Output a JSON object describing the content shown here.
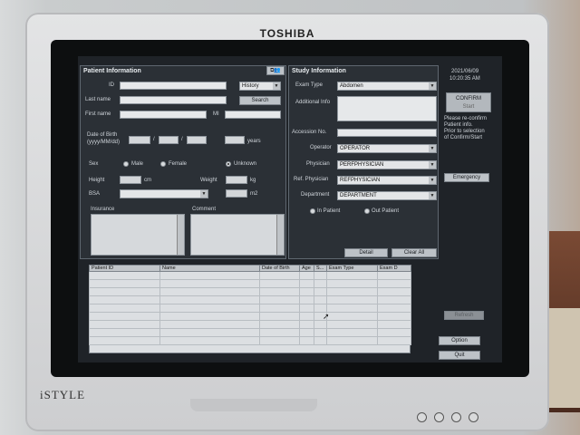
{
  "device": {
    "brand": "TOSHIBA",
    "model": "iSTYLE"
  },
  "patient": {
    "title": "Patient Information",
    "id_label": "ID",
    "history_option": "History",
    "last_name_label": "Last name",
    "search_button": "Search",
    "first_name_label": "First name",
    "mi_label": "MI",
    "dob_label_1": "Date of Birth",
    "dob_label_2": "(yyyy/MM/dd)",
    "slash": "/",
    "years_label": "years",
    "sex_label": "Sex",
    "male": "Male",
    "female": "Female",
    "unknown": "Unknown",
    "height_label": "Height",
    "height_unit": "cm",
    "weight_label": "Weight",
    "weight_unit": "kg",
    "bsa_label": "BSA",
    "bsa_unit": "m2",
    "insurance_label": "Insurance",
    "comment_label": "Comment"
  },
  "study": {
    "title": "Study Information",
    "exam_type_label": "Exam Type",
    "exam_type_value": "Abdomen",
    "additional_info_label": "Additional Info",
    "accession_label": "Accession No.",
    "operator_label": "Operator",
    "operator_value": "OPERATOR",
    "physician_label": "Physician",
    "physician_value": "PERFPHYSICIAN",
    "ref_physician_label": "Ref. Physician",
    "ref_physician_value": "REFPHYSICIAN",
    "department_label": "Department",
    "department_value": "DEPARTMENT",
    "in_patient": "In Patient",
    "out_patient": "Out Patient",
    "detail_button": "Detail",
    "clear_all_button": "Clear All"
  },
  "side": {
    "date": "2021/06/09",
    "time": "10:20:35 AM",
    "confirm_button": "CONFIRM",
    "confirm_sub": "Start",
    "note": [
      "Please re-confirm",
      "Patient info.",
      "Prior to selection",
      "of Confirm/Start"
    ],
    "emergency_button": "Emergency",
    "refresh_button": "Refresh",
    "option_button": "Option",
    "quit_button": "Quit"
  },
  "list": {
    "columns": [
      "Patient ID",
      "Name",
      "Date of Birth",
      "Age",
      "S...",
      "Exam Type",
      "Exam D"
    ]
  }
}
